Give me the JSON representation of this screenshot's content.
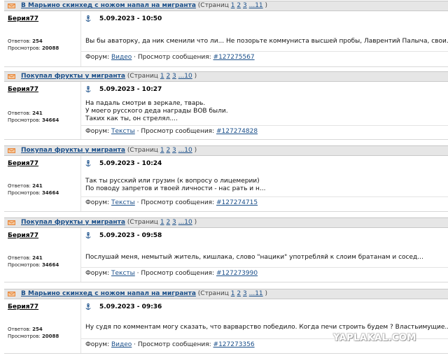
{
  "posts": [
    {
      "topic": "В Марьино скинхед с ножом напал на мигранта",
      "pages_prefix": "(Страниц",
      "pages": [
        "1",
        "2",
        "3",
        "...11"
      ],
      "pages_suffix": ")",
      "user": "Берия77",
      "answers_label": "Ответов:",
      "answers": "254",
      "views_label": "Просмотров:",
      "views": "20088",
      "date": "5.09.2023 - 10:50",
      "lines": [
        "Вы бы аваторку, да ник сменили что ли... Не позорьте коммуниста высшей пробы, Лаврентий Палыча, свои..."
      ],
      "forum_label": "Форум:",
      "forum": "Видео",
      "view_label": "· Просмотр сообщения:",
      "msg_id": "#127275567"
    },
    {
      "topic": "Покупал фрукты у мигранта",
      "pages_prefix": "(Страниц",
      "pages": [
        "1",
        "2",
        "3",
        "...10"
      ],
      "pages_suffix": ")",
      "user": "Берия77",
      "answers_label": "Ответов:",
      "answers": "241",
      "views_label": "Просмотров:",
      "views": "34664",
      "date": "5.09.2023 - 10:27",
      "lines": [
        "На падаль смотри в зеркале, тварь.",
        "У моего русского деда награды ВОВ были.",
        "Таких как ты, он стрелял...."
      ],
      "forum_label": "Форум:",
      "forum": "Тексты",
      "view_label": "· Просмотр сообщения:",
      "msg_id": "#127274828"
    },
    {
      "topic": "Покупал фрукты у мигранта",
      "pages_prefix": "(Страниц",
      "pages": [
        "1",
        "2",
        "3",
        "...10"
      ],
      "pages_suffix": ")",
      "user": "Берия77",
      "answers_label": "Ответов:",
      "answers": "241",
      "views_label": "Просмотров:",
      "views": "34664",
      "date": "5.09.2023 - 10:24",
      "lines": [
        "Так ты русский или грузин (к вопросу о лицемерии)",
        "По поводу запретов и твоей личности - нас рать и н..."
      ],
      "forum_label": "Форум:",
      "forum": "Тексты",
      "view_label": "· Просмотр сообщения:",
      "msg_id": "#127274715"
    },
    {
      "topic": "Покупал фрукты у мигранта",
      "pages_prefix": "(Страниц",
      "pages": [
        "1",
        "2",
        "3",
        "...10"
      ],
      "pages_suffix": ")",
      "user": "Берия77",
      "answers_label": "Ответов:",
      "answers": "241",
      "views_label": "Просмотров:",
      "views": "34664",
      "date": "5.09.2023 - 09:58",
      "lines": [
        "Послушай меня, немытый житель, кишлака, слово \"нацики\" употребляй к слоим братанам и сосед..."
      ],
      "forum_label": "Форум:",
      "forum": "Тексты",
      "view_label": "· Просмотр сообщения:",
      "msg_id": "#127273990"
    },
    {
      "topic": "В Марьино скинхед с ножом напал на мигранта",
      "pages_prefix": "(Страниц",
      "pages": [
        "1",
        "2",
        "3",
        "...11"
      ],
      "pages_suffix": ")",
      "user": "Берия77",
      "answers_label": "Ответов:",
      "answers": "254",
      "views_label": "Просмотров:",
      "views": "20088",
      "date": "5.09.2023 - 09:36",
      "lines": [
        "Ну судя по комментам могу сказать, что варварство победило. Когда печи строить будем ? Властьимущие..."
      ],
      "forum_label": "Форум:",
      "forum": "Видео",
      "view_label": "· Просмотр сообщения:",
      "msg_id": "#127273356"
    }
  ],
  "watermark": "YAPLAKAL.COM",
  "colors": {
    "link": "#1a4f8a",
    "header_bg": "#e6e6e6",
    "envelope": "#e8863a"
  },
  "icons": {
    "topic": "envelope-icon",
    "post": "anchor-icon"
  }
}
